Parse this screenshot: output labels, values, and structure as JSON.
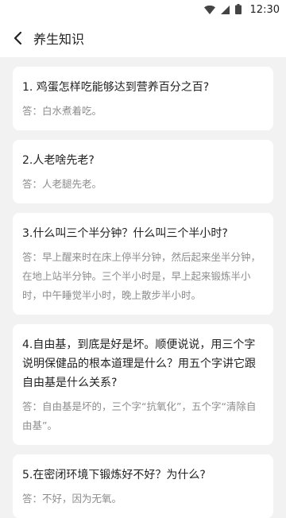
{
  "status_bar": {
    "time": "12:30"
  },
  "app_bar": {
    "title": "养生知识"
  },
  "cards": [
    {
      "question": "1. 鸡蛋怎样吃能够达到营养百分之百?",
      "answer": "答：白水煮着吃。"
    },
    {
      "question": "2.人老啥先老?",
      "answer": "答：人老腿先老。"
    },
    {
      "question": "3.什么叫三个半分钟？什么叫三个半小时?",
      "answer": "答：早上醒来时在床上停半分钟，然后起来坐半分钟，在地上站半分钟。三个半小时是，早上起来锻炼半小时，中午睡觉半小时，晚上散步半小时。"
    },
    {
      "question": "4.自由基，到底是好是坏。顺便说说，用三个字说明保健品的根本道理是什么？用五个字讲它跟自由基是什么关系?",
      "answer": "答：自由基是坏的，三个字“抗氧化”，五个字“清除自由基”。"
    },
    {
      "question": "5.在密闭环境下锻炼好不好？为什么?",
      "answer": "答：不好，因为无氧。"
    }
  ]
}
